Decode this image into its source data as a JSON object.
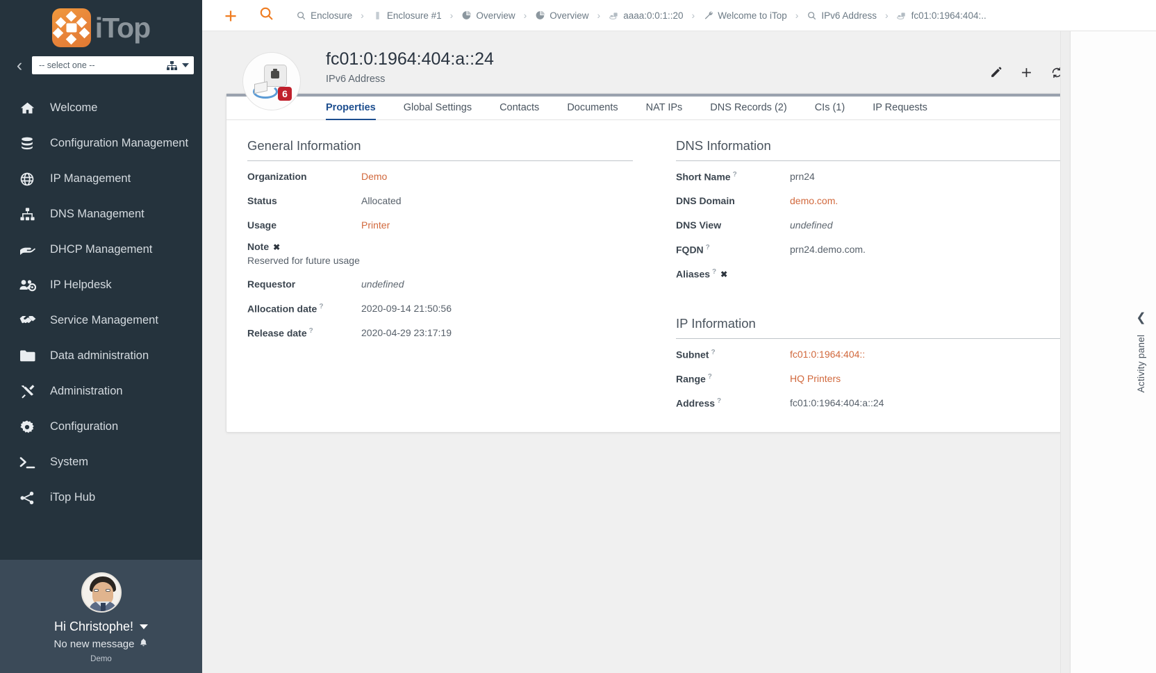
{
  "brand": {
    "name": "iTop",
    "logo_color": "#e8843a"
  },
  "sidebar": {
    "org_select": {
      "value": "-- select one --",
      "icon": "hierarchy-icon"
    },
    "collapse_icon": "chevron-left-icon",
    "items": [
      {
        "label": "Welcome",
        "icon": "home-icon"
      },
      {
        "label": "Configuration Management",
        "icon": "database-icon"
      },
      {
        "label": "IP Management",
        "icon": "globe-icon"
      },
      {
        "label": "DNS Management",
        "icon": "sitemap-icon"
      },
      {
        "label": "DHCP Management",
        "icon": "hand-holding-icon"
      },
      {
        "label": "IP Helpdesk",
        "icon": "users-cog-icon"
      },
      {
        "label": "Service Management",
        "icon": "hands-helping-icon"
      },
      {
        "label": "Data administration",
        "icon": "folder-icon"
      },
      {
        "label": "Administration",
        "icon": "tools-icon"
      },
      {
        "label": "Configuration",
        "icon": "gear-icon"
      },
      {
        "label": "System",
        "icon": "terminal-icon"
      },
      {
        "label": "iTop Hub",
        "icon": "share-nodes-icon"
      }
    ],
    "user": {
      "greeting": "Hi Christophe!",
      "messages": "No new message",
      "organization": "Demo"
    }
  },
  "topbar": {
    "new_label": "+",
    "search_icon": "search-icon",
    "breadcrumbs": [
      {
        "label": "Enclosure",
        "icon": "search-icon"
      },
      {
        "label": "Enclosure #1",
        "icon": "rack-icon"
      },
      {
        "label": "Overview",
        "icon": "pie-chart-icon"
      },
      {
        "label": "Overview",
        "icon": "pie-chart-icon"
      },
      {
        "label": "aaaa:0:0:1::20",
        "icon": "ip-address-icon"
      },
      {
        "label": "Welcome to iTop",
        "icon": "wrench-icon"
      },
      {
        "label": "IPv6 Address",
        "icon": "search-icon"
      },
      {
        "label": "fc01:0:1964:404:..",
        "icon": "ip-address-icon"
      }
    ],
    "separator": "›"
  },
  "object": {
    "title": "fc01:0:1964:404:a::24",
    "subtitle": "IPv6 Address",
    "icon": "ipv6-device-icon",
    "badge": "6",
    "actions": [
      {
        "name": "edit",
        "icon": "pencil-icon"
      },
      {
        "name": "new",
        "icon": "plus-icon"
      },
      {
        "name": "refresh",
        "icon": "refresh-icon"
      },
      {
        "name": "search",
        "icon": "search-icon"
      },
      {
        "name": "more",
        "icon": "ellipsis-vertical-icon"
      }
    ],
    "tabs": [
      {
        "label": "Properties",
        "active": true
      },
      {
        "label": "Global Settings",
        "active": false
      },
      {
        "label": "Contacts",
        "active": false
      },
      {
        "label": "Documents",
        "active": false
      },
      {
        "label": "NAT IPs",
        "active": false
      },
      {
        "label": "DNS Records (2)",
        "active": false
      },
      {
        "label": "CIs (1)",
        "active": false
      },
      {
        "label": "IP Requests",
        "active": false
      }
    ]
  },
  "general_information": {
    "title": "General Information",
    "fields": [
      {
        "label": "Organization",
        "value": "Demo",
        "style": "link",
        "help": false
      },
      {
        "label": "Status",
        "value": "Allocated",
        "style": "plain",
        "help": false
      },
      {
        "label": "Usage",
        "value": "Printer",
        "style": "link",
        "help": false
      },
      {
        "label": "Requestor",
        "value": "undefined",
        "style": "undef",
        "help": false
      },
      {
        "label": "Allocation date",
        "value": "2020-09-14 21:50:56",
        "style": "plain",
        "help": true
      },
      {
        "label": "Release date",
        "value": "2020-04-29 23:17:19",
        "style": "plain",
        "help": true
      }
    ],
    "note": {
      "label": "Note",
      "text": "Reserved for future usage",
      "expand_icon": "expand-icon"
    }
  },
  "dns_information": {
    "title": "DNS Information",
    "fields": [
      {
        "label": "Short Name",
        "value": "prn24",
        "style": "plain",
        "help": true
      },
      {
        "label": "DNS Domain",
        "value": "demo.com.",
        "style": "link",
        "help": false
      },
      {
        "label": "DNS View",
        "value": "undefined",
        "style": "undef",
        "help": false
      },
      {
        "label": "FQDN",
        "value": "prn24.demo.com.",
        "style": "plain",
        "help": true
      }
    ],
    "aliases": {
      "label": "Aliases",
      "value": "",
      "help": true,
      "expand_icon": "expand-icon"
    }
  },
  "ip_information": {
    "title": "IP Information",
    "fields": [
      {
        "label": "Subnet",
        "value": "fc01:0:1964:404::",
        "style": "link",
        "help": true
      },
      {
        "label": "Range",
        "value": "HQ Printers",
        "style": "link",
        "help": true
      },
      {
        "label": "Address",
        "value": "fc01:0:1964:404:a::24",
        "style": "plain",
        "help": true
      }
    ]
  },
  "activity_panel": {
    "label": "Activity panel",
    "chevron": "chevron-left-icon"
  },
  "colors": {
    "sidebar_bg": "#25333d",
    "user_bg": "#3b4a58",
    "accent_orange": "#ef7d22",
    "link_orange": "#d1683c",
    "tab_active": "#1d4e8f",
    "page_bg": "#f0f0f0"
  }
}
